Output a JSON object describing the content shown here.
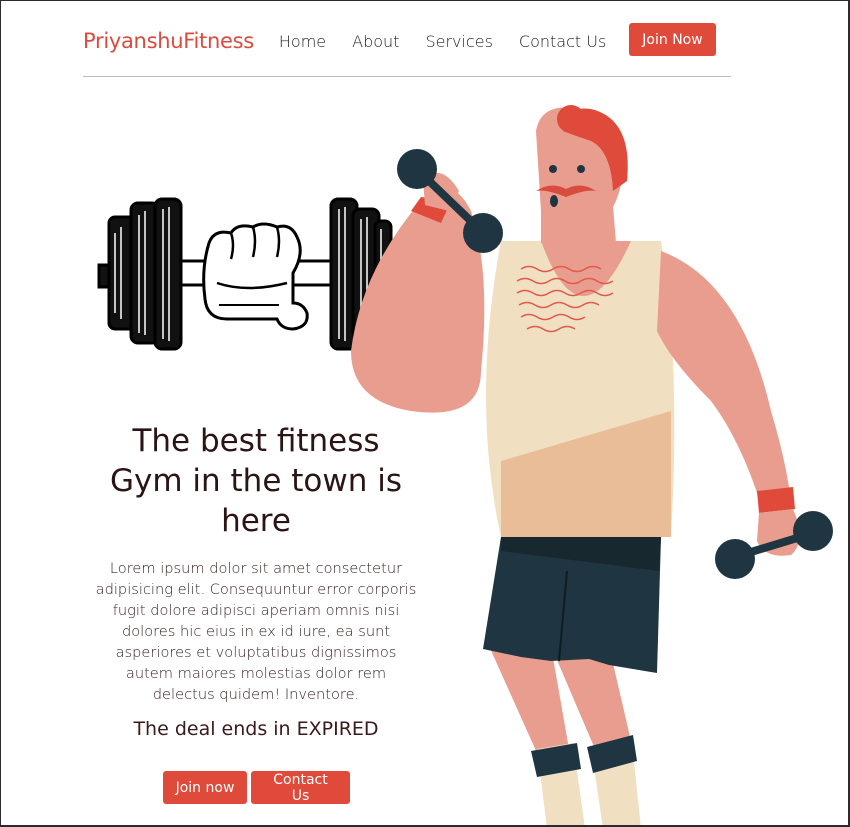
{
  "header": {
    "brand": "PriyanshuFitness",
    "nav": [
      "Home",
      "About",
      "Services",
      "Contact Us"
    ],
    "join_label": "Join Now"
  },
  "hero": {
    "title_lines": [
      "The best fitness",
      "Gym in the town is",
      "here"
    ],
    "description": "Lorem ipsum dolor sit amet consectetur adipisicing elit. Consequuntur error corporis fugit dolore adipisci aperiam omnis nisi dolores hic eius in ex id iure, ea sunt asperiores et voluptatibus dignissimos autem maiores molestias dolor rem delectus quidem! Inventore.",
    "deal_text": "The deal ends in EXPIRED",
    "join_now_label": "Join now",
    "contact_label": "Contact Us"
  },
  "colors": {
    "accent": "#e04a3b",
    "brand": "#d94b3f",
    "skin": "#e99d8e",
    "tank": "#f1dfc1",
    "shorts": "#1f3542"
  },
  "illustrations": {
    "dumbbell_icon": "dumbbell-fist-icon",
    "man_icon": "weightlifter-illustration"
  }
}
